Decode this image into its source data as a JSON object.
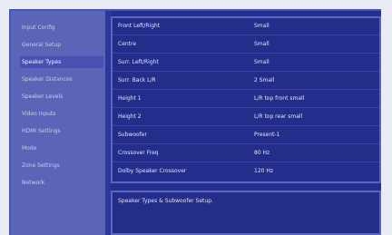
{
  "sidebar": {
    "items": [
      {
        "label": "Input Config"
      },
      {
        "label": "General Setup"
      },
      {
        "label": "Speaker Types",
        "selected": true
      },
      {
        "label": "Speaker Distances"
      },
      {
        "label": "Speaker Levels"
      },
      {
        "label": "Video Inputs"
      },
      {
        "label": "HDMI Settings"
      },
      {
        "label": "Mode"
      },
      {
        "label": "Zone Settings"
      },
      {
        "label": "Network"
      }
    ]
  },
  "settings": {
    "rows": [
      {
        "label": "Front Left/Right",
        "value": "Small"
      },
      {
        "label": "Centre",
        "value": "Small"
      },
      {
        "label": "Surr. Left/Right",
        "value": "Small"
      },
      {
        "label": "Surr. Back L/R",
        "value": "2 Small"
      },
      {
        "label": "Height 1",
        "value": "L/R top front small"
      },
      {
        "label": "Height 2",
        "value": "L/R top rear small"
      },
      {
        "label": "Subwoofer",
        "value": "Present-1"
      },
      {
        "label": "Crossover Freq",
        "value": "80 Hz"
      },
      {
        "label": "Dolby Speaker Crossover",
        "value": "120 Hz"
      }
    ]
  },
  "info": {
    "text": "Speaker Types & Subwoofer Setup."
  },
  "colors": {
    "background": "#252f8f",
    "sidebar": "#5a65b8",
    "selected": "#4850b2",
    "text": "#e4e6ff"
  }
}
